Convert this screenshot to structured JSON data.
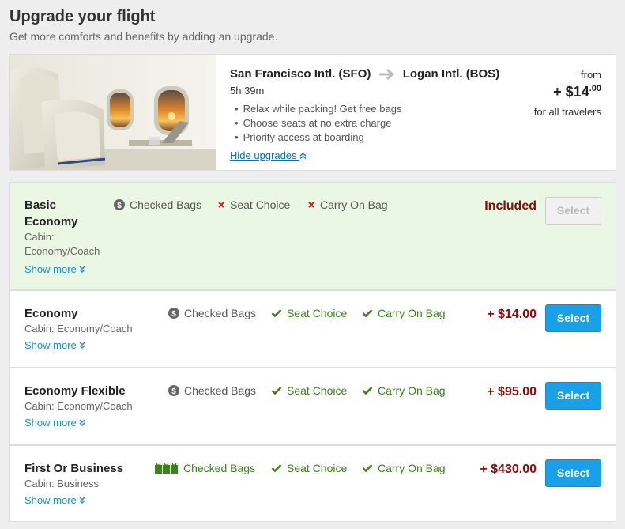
{
  "header": {
    "title": "Upgrade your flight",
    "subtitle": "Get more comforts and benefits by adding an upgrade."
  },
  "flight": {
    "origin": "San Francisco Intl. (SFO)",
    "destination": "Logan Intl. (BOS)",
    "duration": "5h 39m",
    "perks": [
      "Relax while packing! Get free bags",
      "Choose seats at no extra charge",
      "Priority access at boarding"
    ],
    "hide_link": "Hide upgrades",
    "price_from_label": "from",
    "price_prefix": "+ $14",
    "price_cents": ".00",
    "price_note": "for all travelers"
  },
  "fares": [
    {
      "name_line1": "Basic",
      "name_line2": "Economy",
      "cabin_line1": "Cabin:",
      "cabin_line2": "Economy/Coach",
      "show_more": "Show more",
      "features": [
        {
          "label": "Checked Bags",
          "icon": "dollar-circle-icon"
        },
        {
          "label": "Seat Choice",
          "icon": "x-icon"
        },
        {
          "label": "Carry On Bag",
          "icon": "x-icon"
        }
      ],
      "price": "Included",
      "button": "Select",
      "state": "selected-included"
    },
    {
      "name": "Economy",
      "cabin": "Cabin: Economy/Coach",
      "show_more": "Show more",
      "features": [
        {
          "label": "Checked Bags",
          "icon": "dollar-circle-icon"
        },
        {
          "label": "Seat Choice",
          "icon": "check-icon"
        },
        {
          "label": "Carry On Bag",
          "icon": "check-icon"
        }
      ],
      "price": "+ $14.00",
      "button": "Select"
    },
    {
      "name": "Economy Flexible",
      "cabin": "Cabin: Economy/Coach",
      "show_more": "Show more",
      "features": [
        {
          "label": "Checked Bags",
          "icon": "dollar-circle-icon"
        },
        {
          "label": "Seat Choice",
          "icon": "check-icon"
        },
        {
          "label": "Carry On Bag",
          "icon": "check-icon"
        }
      ],
      "price": "+ $95.00",
      "button": "Select"
    },
    {
      "name": "First Or Business",
      "cabin": "Cabin: Business",
      "show_more": "Show more",
      "features": [
        {
          "label": "Checked Bags",
          "icon": "luggage-icon"
        },
        {
          "label": "Seat Choice",
          "icon": "check-icon"
        },
        {
          "label": "Carry On Bag",
          "icon": "check-icon"
        }
      ],
      "price": "+ $430.00",
      "button": "Select"
    }
  ],
  "colors": {
    "included_bg": "#e9f7e4",
    "price_red": "#8b0a0a",
    "check_green": "#3f7f1e",
    "x_red": "#c0201e",
    "button_blue": "#1aa0e6",
    "link_blue": "#1a8fd1"
  }
}
